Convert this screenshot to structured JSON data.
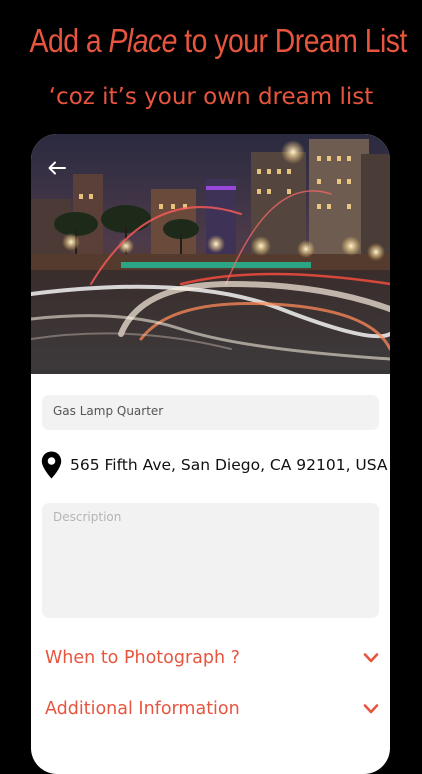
{
  "promo": {
    "title_prefix": "Add a ",
    "title_emphasis": "Place",
    "title_suffix": " to your Dream List",
    "subtitle": "‘coz it’s your own dream list"
  },
  "place": {
    "name_value": "Gas Lamp Quarter",
    "address": "565 Fifth Ave, San Diego, CA 92101, USA",
    "description_placeholder": "Description"
  },
  "sections": [
    {
      "label": "When to Photograph ?",
      "icon": "chevron-down-icon"
    },
    {
      "label": "Additional Information",
      "icon": "chevron-down-icon"
    }
  ],
  "colors": {
    "accent": "#e8553f",
    "background": "#000000",
    "field": "#f2f2f2"
  }
}
